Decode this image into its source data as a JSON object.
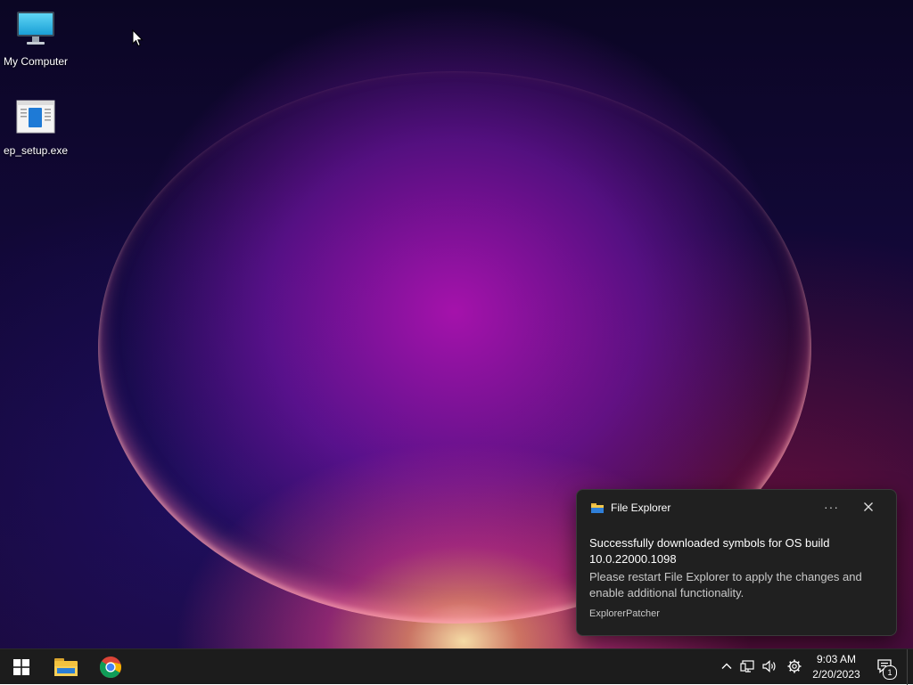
{
  "desktop": {
    "icons": [
      {
        "label": "My Computer",
        "icon": "monitor-icon"
      },
      {
        "label": "ep_setup.exe",
        "icon": "installer-icon"
      }
    ]
  },
  "toast": {
    "app_name": "File Explorer",
    "app_icon": "folder-icon",
    "more_label": "···",
    "title": "Successfully downloaded symbols for OS build 10.0.22000.1098",
    "text": "Please restart File Explorer to apply the changes and enable additional functionality.",
    "attribution": "ExplorerPatcher"
  },
  "taskbar": {
    "pinned": [
      {
        "name": "start",
        "icon": "windows-logo-icon"
      },
      {
        "name": "file-explorer",
        "icon": "folder-icon"
      },
      {
        "name": "chrome",
        "icon": "chrome-icon"
      }
    ],
    "tray": [
      "chevron-up-icon",
      "network-icon",
      "volume-icon",
      "settings-gear-icon"
    ],
    "clock": {
      "time": "9:03 AM",
      "date": "2/20/2023"
    },
    "notifications_badge": "1"
  },
  "colors": {
    "taskbar_bg": "#1c1c1c",
    "toast_bg": "#202020",
    "accent_wallpaper": "#b01cb8"
  }
}
